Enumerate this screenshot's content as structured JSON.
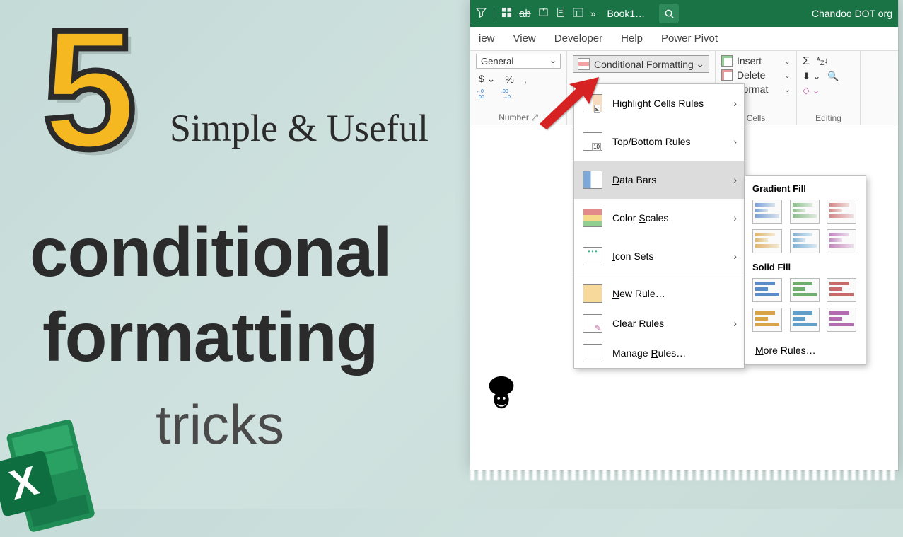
{
  "left": {
    "big_number": "5",
    "handwritten": "Simple & Useful",
    "line1": "conditional",
    "line2": "formatting",
    "line3": "tricks"
  },
  "titlebar": {
    "book": "Book1…",
    "brand": "Chandoo DOT org"
  },
  "menubar": {
    "items": [
      "iew",
      "View",
      "Developer",
      "Help",
      "Power Pivot"
    ]
  },
  "ribbon": {
    "number_format": "General",
    "currency": "$",
    "percent": "%",
    "comma": ",",
    "dec_inc": "←0 .00",
    "dec_dec": ".00 →0",
    "group_number": "Number",
    "cf_button": "Conditional Formatting",
    "cells": {
      "insert": "Insert",
      "delete": "Delete",
      "format": "Format",
      "label": "Cells"
    },
    "editing": {
      "sigma": "Σ",
      "az": "A↓Z",
      "fill": "⬇",
      "sort": "▽",
      "clear": "◇",
      "label": "Editing"
    }
  },
  "cf_menu": {
    "items": [
      {
        "label": "Highlight Cells Rules",
        "accel": "H",
        "icon": "hcr"
      },
      {
        "label": "Top/Bottom Rules",
        "accel": "T",
        "icon": "tbr"
      },
      {
        "label": "Data Bars",
        "accel": "D",
        "icon": "dbars",
        "selected": true
      },
      {
        "label": "Color Scales",
        "accel": "S",
        "icon": "cscale"
      },
      {
        "label": "Icon Sets",
        "accel": "I",
        "icon": "isets"
      }
    ],
    "footer": [
      {
        "label": "New Rule…",
        "accel": "N",
        "icon": "nrule"
      },
      {
        "label": "Clear Rules",
        "accel": "C",
        "icon": "crule",
        "arrow": true
      },
      {
        "label": "Manage Rules…",
        "accel": "R",
        "icon": "mrule"
      }
    ]
  },
  "db_gallery": {
    "gradient": "Gradient Fill",
    "solid": "Solid Fill",
    "more": "More Rules…",
    "more_accel": "M",
    "colors": [
      "#5b8bc9",
      "#6fae6f",
      "#c96a6a",
      "#d9a447",
      "#5f9fc9",
      "#b46ab0"
    ]
  }
}
